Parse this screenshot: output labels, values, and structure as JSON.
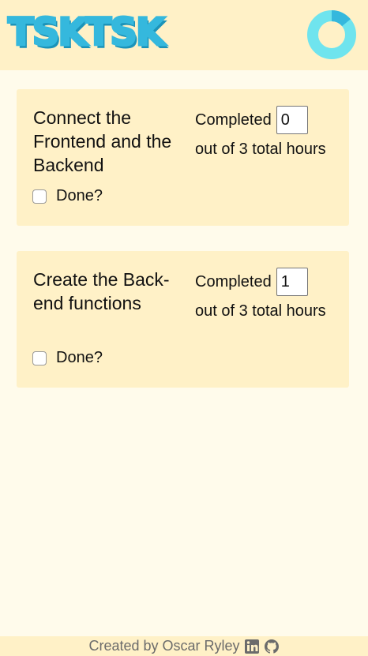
{
  "header": {
    "logo_text": "TSKTSK",
    "brand_color": "#35b8dd",
    "progress_ring": {
      "icon": "progress-ring-icon",
      "progress": 0.14,
      "track_color": "#35b8dd",
      "fill_color": "#6fe4ee"
    }
  },
  "tasks": [
    {
      "title": "Connect the Frontend and the Backend",
      "done_label": "Done?",
      "done": false,
      "completed_label": "Completed",
      "completed_hours": "0",
      "total_label": "out of 3 total hours"
    },
    {
      "title": "Create the Back-end functions",
      "done_label": "Done?",
      "done": false,
      "completed_label": "Completed",
      "completed_hours": "1",
      "total_label": "out of 3 total hours"
    }
  ],
  "footer": {
    "credit": "Created by Oscar Ryley",
    "icons": [
      "linkedin-icon",
      "github-icon"
    ]
  }
}
